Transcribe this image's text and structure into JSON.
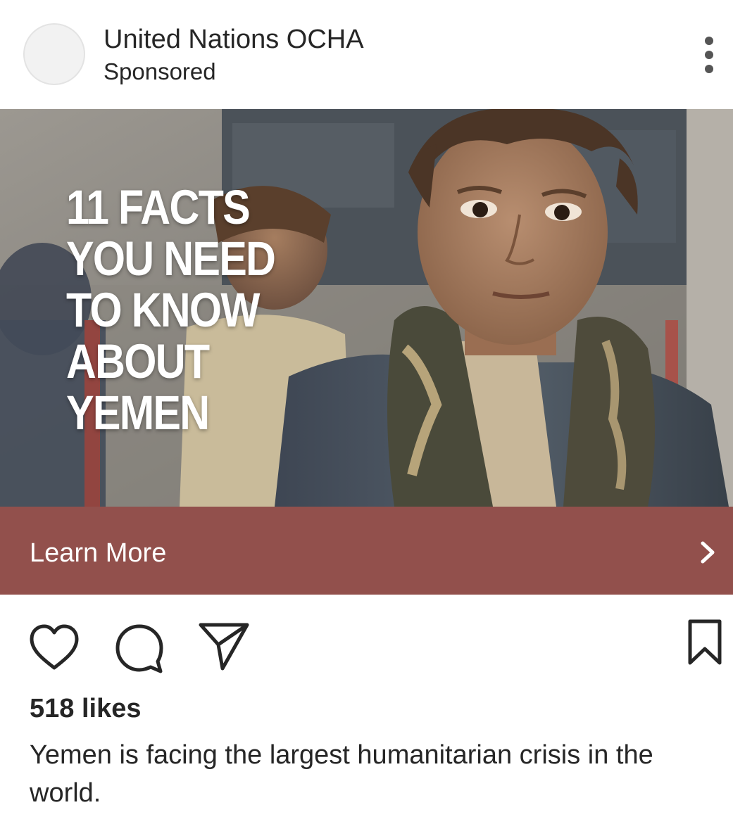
{
  "header": {
    "account_name": "United Nations OCHA",
    "label": "Sponsored",
    "avatar_icon": "avatar-placeholder",
    "more_icon": "more-vertical-icon"
  },
  "media": {
    "headline_lines": [
      "11 FACTS",
      "YOU NEED",
      "TO KNOW",
      "ABOUT",
      "YEMEN"
    ]
  },
  "cta": {
    "label": "Learn More",
    "icon": "chevron-right-icon",
    "color": "#92504c"
  },
  "actions": {
    "icons": [
      "heart-icon",
      "comment-icon",
      "send-icon",
      "bookmark-icon"
    ]
  },
  "post": {
    "likes": "518 likes",
    "caption": "Yemen is facing the largest humanitarian crisis in the world."
  }
}
